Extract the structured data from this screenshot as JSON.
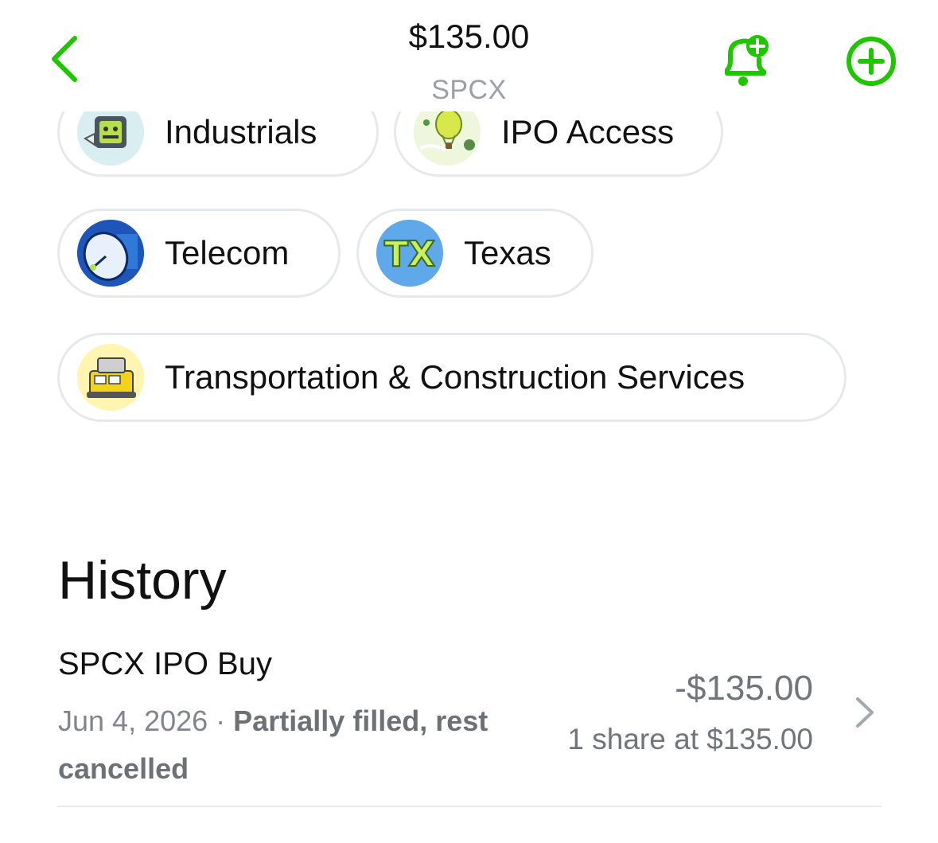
{
  "header": {
    "price": "$135.00",
    "ticker": "SPCX",
    "accent_color": "#1fc600"
  },
  "categories": [
    {
      "label": "Industrials",
      "icon": "industrials-robot-icon"
    },
    {
      "label": "IPO Access",
      "icon": "ipo-hot-air-balloon-icon"
    },
    {
      "label": "Telecom",
      "icon": "satellite-dish-icon"
    },
    {
      "label": "Texas",
      "icon": "texas-tx-icon"
    },
    {
      "label": "Transportation & Construction Services",
      "icon": "construction-vehicle-icon"
    }
  ],
  "history": {
    "title": "History",
    "items": [
      {
        "title": "SPCX IPO Buy",
        "date": "Jun 4, 2026",
        "separator": " · ",
        "status": "Partially filled, rest cancelled",
        "amount": "-$135.00",
        "detail": "1 share at $135.00"
      }
    ]
  }
}
